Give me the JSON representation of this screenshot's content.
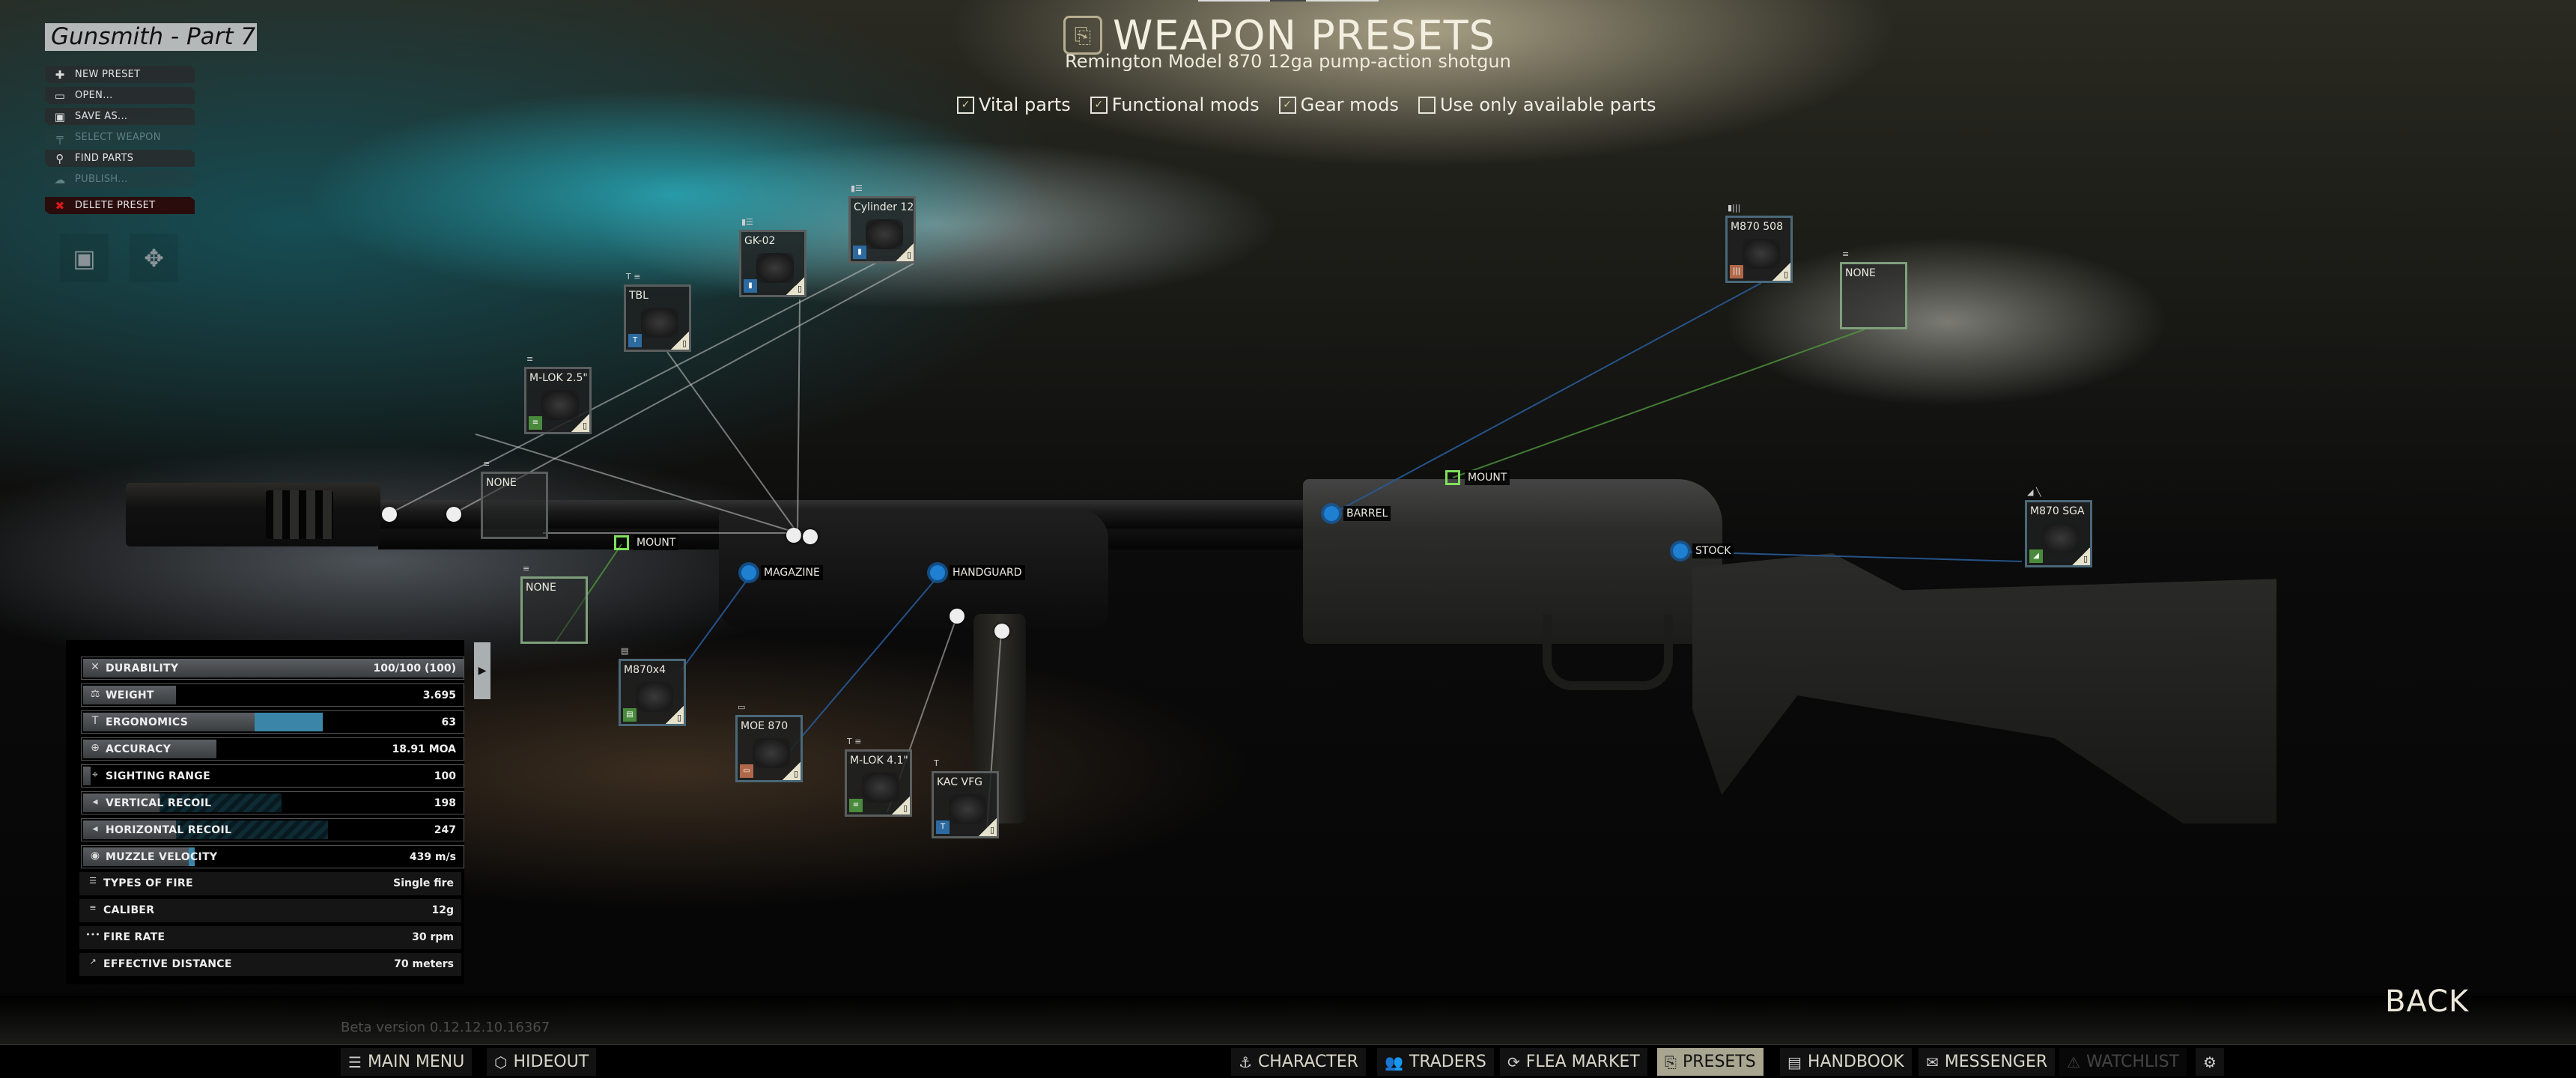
{
  "preset_name": "Gunsmith - Part 7",
  "menu": [
    {
      "label": "NEW PRESET",
      "icon": "new-preset-icon",
      "glyph": "✚",
      "state": "enabled"
    },
    {
      "label": "OPEN...",
      "icon": "folder-icon",
      "glyph": "▭",
      "state": "enabled"
    },
    {
      "label": "SAVE AS...",
      "icon": "save-icon",
      "glyph": "▣",
      "state": "enabled"
    },
    {
      "label": "SELECT WEAPON",
      "icon": "weapon-icon",
      "glyph": "╤",
      "state": "disabled"
    },
    {
      "label": "FIND PARTS",
      "icon": "search-icon",
      "glyph": "⚲",
      "state": "enabled"
    },
    {
      "label": "PUBLISH...",
      "icon": "cloud-upload-icon",
      "glyph": "☁",
      "state": "disabled"
    },
    {
      "label": "DELETE PRESET",
      "icon": "delete-icon",
      "glyph": "✖",
      "state": "danger"
    }
  ],
  "tools": {
    "save_glyph": "▣",
    "modding_glyph": "✥"
  },
  "header": {
    "title": "WEAPON PRESETS",
    "title_icon_glyph": "⎘",
    "subtitle": "Remington Model 870 12ga pump-action shotgun"
  },
  "filters": [
    {
      "label": "Vital parts",
      "checked": true
    },
    {
      "label": "Functional mods",
      "checked": true
    },
    {
      "label": "Gear mods",
      "checked": true
    },
    {
      "label": "Use only available parts",
      "checked": false
    }
  ],
  "check_glyph": "✓",
  "parts": {
    "cylinder12": {
      "name": "Cylinder 12"
    },
    "gk02": {
      "name": "GK-02"
    },
    "tbl": {
      "name": "TBL"
    },
    "mlok25": {
      "name": "M-LOK 2.5\""
    },
    "none_barrel_top": {
      "name": "NONE"
    },
    "none_mount": {
      "name": "NONE"
    },
    "m870x4": {
      "name": "M870x4"
    },
    "moe870": {
      "name": "MOE 870"
    },
    "mlok41": {
      "name": "M-LOK 4.1\""
    },
    "kacvfg": {
      "name": "KAC VFG"
    },
    "m870_508": {
      "name": "M870 508"
    },
    "none_receiver_mount": {
      "name": "NONE"
    },
    "m870_sga": {
      "name": "M870 SGA"
    }
  },
  "hotspots": {
    "mount_left": "MOUNT",
    "magazine": "MAGAZINE",
    "handguard": "HANDGUARD",
    "barrel": "BARREL",
    "mount_receiver": "MOUNT",
    "stock": "STOCK"
  },
  "stats": {
    "bars": [
      {
        "label": "DURABILITY",
        "value": "100/100 (100)",
        "icon": "wrench-icon",
        "glyph": "✕",
        "fill": 1.0
      },
      {
        "label": "WEIGHT",
        "value": "3.695",
        "icon": "weight-icon",
        "glyph": "⚖",
        "fill": 0.245
      },
      {
        "label": "ERGONOMICS",
        "value": "63",
        "icon": "ergonomics-icon",
        "glyph": "T",
        "fill": 0.45,
        "extra": 0.18,
        "extra_type": "blue"
      },
      {
        "label": "ACCURACY",
        "value": "18.91 MOA",
        "icon": "accuracy-icon",
        "glyph": "⊕",
        "fill": 0.35
      },
      {
        "label": "SIGHTING RANGE",
        "value": "100",
        "icon": "sighting-icon",
        "glyph": "⌖",
        "fill": 0.02
      },
      {
        "label": "VERTICAL RECOIL",
        "value": "198",
        "icon": "recoil-icon",
        "glyph": "◂",
        "fill": 0.2,
        "extra": 0.32,
        "extra_type": "hatch"
      },
      {
        "label": "HORIZONTAL RECOIL",
        "value": "247",
        "icon": "recoil-icon",
        "glyph": "◂",
        "fill": 0.245,
        "extra": 0.4,
        "extra_type": "hatch"
      },
      {
        "label": "MUZZLE VELOCITY",
        "value": "439 m/s",
        "icon": "muzzle-velocity-icon",
        "glyph": "◉",
        "fill": 0.277,
        "extra": 0.015,
        "extra_type": "blue"
      }
    ],
    "info": [
      {
        "label": "TYPES OF FIRE",
        "value": "Single fire",
        "icon": "fire-mode-icon",
        "glyph": "☰"
      },
      {
        "label": "CALIBER",
        "value": "12g",
        "icon": "caliber-icon",
        "glyph": "≡"
      },
      {
        "label": "FIRE RATE",
        "value": "30 rpm",
        "icon": "fire-rate-icon",
        "glyph": "•••"
      },
      {
        "label": "EFFECTIVE DISTANCE",
        "value": "70 meters",
        "icon": "distance-icon",
        "glyph": "↗"
      }
    ],
    "toggle_glyph": "▶"
  },
  "version": "Beta version 0.12.12.10.16367",
  "back_label": "BACK",
  "nav_left": [
    {
      "label": "MAIN MENU",
      "glyph": "☰"
    },
    {
      "label": "HIDEOUT",
      "glyph": "⬡"
    }
  ],
  "nav_right": [
    {
      "label": "CHARACTER",
      "glyph": "⚓",
      "state": "normal"
    },
    {
      "label": "TRADERS",
      "glyph": "👥",
      "state": "normal"
    },
    {
      "label": "FLEA MARKET",
      "glyph": "⟳",
      "state": "normal"
    },
    {
      "label": "PRESETS",
      "glyph": "⎘",
      "state": "active"
    },
    {
      "label": "HANDBOOK",
      "glyph": "▤",
      "state": "normal"
    },
    {
      "label": "MESSENGER",
      "glyph": "✉",
      "state": "normal"
    },
    {
      "label": "WATCHLIST",
      "glyph": "⚠",
      "state": "disabled"
    }
  ],
  "settings_glyph": "⚙"
}
